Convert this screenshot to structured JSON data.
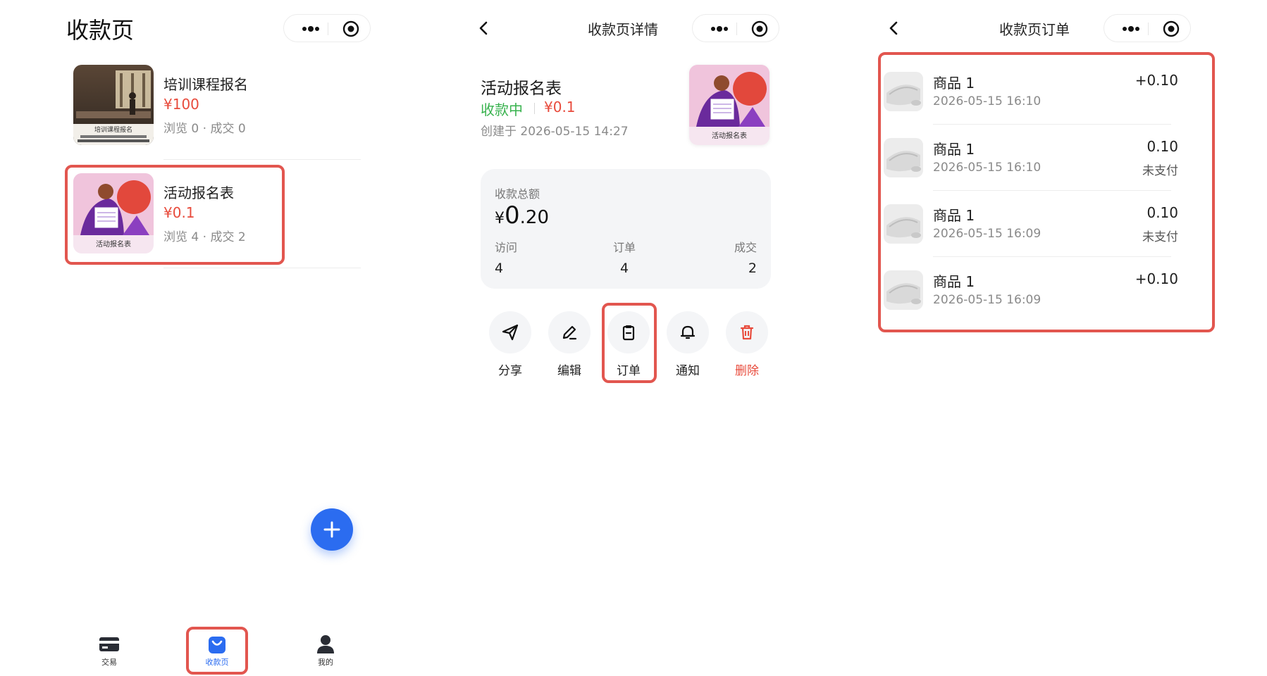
{
  "screen1": {
    "title": "收款页",
    "items": [
      {
        "name": "培训课程报名",
        "price": "¥100",
        "views": "浏览 0",
        "dot": "·",
        "deals": "成交 0",
        "thumb_caption": "培训课程报名"
      },
      {
        "name": "活动报名表",
        "price": "¥0.1",
        "views": "浏览 4",
        "dot": "·",
        "deals": "成交 2",
        "thumb_caption": "活动报名表"
      }
    ],
    "tabs": [
      {
        "label": "交易",
        "icon": "card-icon"
      },
      {
        "label": "收款页",
        "icon": "bag-icon",
        "active": true
      },
      {
        "label": "我的",
        "icon": "user-icon"
      }
    ]
  },
  "screen2": {
    "nav_title": "收款页详情",
    "title": "活动报名表",
    "status": "收款中",
    "price": "¥0.1",
    "created": "创建于 2026-05-15 14:27",
    "thumb_caption": "活动报名表",
    "summary": {
      "label": "收款总额",
      "currency": "¥",
      "integer": "0",
      "decimal": ".20",
      "visits_label": "访问",
      "visits": "4",
      "orders_label": "订单",
      "orders": "4",
      "deals_label": "成交",
      "deals": "2"
    },
    "actions": [
      {
        "label": "分享",
        "icon": "send-icon"
      },
      {
        "label": "编辑",
        "icon": "pencil-icon"
      },
      {
        "label": "订单",
        "icon": "clipboard-icon"
      },
      {
        "label": "通知",
        "icon": "bell-icon"
      },
      {
        "label": "删除",
        "icon": "trash-icon"
      }
    ]
  },
  "screen3": {
    "nav_title": "收款页订单",
    "orders": [
      {
        "name": "商品 1",
        "time": "2026-05-15 16:10",
        "amount": "+0.10",
        "status": ""
      },
      {
        "name": "商品 1",
        "time": "2026-05-15 16:10",
        "amount": "0.10",
        "status": "未支付"
      },
      {
        "name": "商品 1",
        "time": "2026-05-15 16:09",
        "amount": "0.10",
        "status": "未支付"
      },
      {
        "name": "商品 1",
        "time": "2026-05-15 16:09",
        "amount": "+0.10",
        "status": ""
      }
    ]
  },
  "colors": {
    "accent": "#2b6cf0",
    "price_red": "#e84b3c",
    "status_green": "#37b24d",
    "highlight": "#e2564f"
  }
}
